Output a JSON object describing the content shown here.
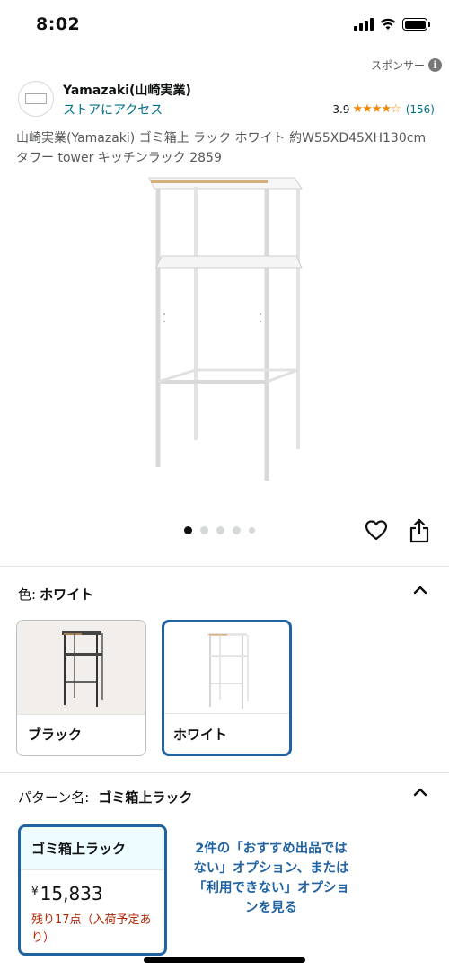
{
  "status_bar": {
    "time": "8:02"
  },
  "sponsor": {
    "label": "スポンサー"
  },
  "brand": {
    "name": "Yamazaki(山崎実業)",
    "store_link": "ストアにアクセス",
    "rating": "3.9",
    "rating_count": "(156)"
  },
  "product": {
    "title": "山崎実業(Yamazaki) ゴミ箱上 ラック ホワイト 約W55XD45XH130cm タワー tower キッチンラック 2859"
  },
  "carousel": {
    "total": 5,
    "active_index": 0
  },
  "color": {
    "label": "色:",
    "selected": "ホワイト",
    "options": [
      {
        "label": "ブラック"
      },
      {
        "label": "ホワイト"
      }
    ]
  },
  "pattern": {
    "label": "パターン名:",
    "selected": "ゴミ箱上ラック",
    "card": {
      "name": "ゴミ箱上ラック",
      "price_symbol": "¥",
      "price": "15,833",
      "stock": "残り17点（入荷予定あり）"
    },
    "other_options": "2件の「おすすめ出品ではない」オプション、または「利用できない」オプションを見る"
  },
  "colors": {
    "link": "#007185",
    "selected_border": "#2162a1",
    "star": "#f08804",
    "stock_warning": "#b12704"
  }
}
